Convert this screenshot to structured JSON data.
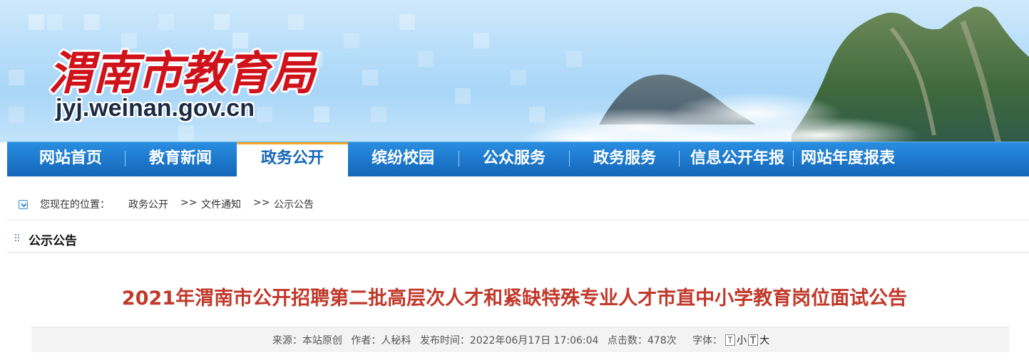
{
  "site": {
    "logo_cn": "渭南市教育局",
    "logo_url": "jyj.weinan.gov.cn"
  },
  "nav": {
    "items": [
      {
        "label": "网站首页"
      },
      {
        "label": "教育新闻"
      },
      {
        "label": "政务公开"
      },
      {
        "label": "缤纷校园"
      },
      {
        "label": "公众服务"
      },
      {
        "label": "政务服务"
      },
      {
        "label": "信息公开年报"
      },
      {
        "label": "网站年度报表"
      }
    ],
    "active_index": 2,
    "colors": {
      "bar": "#1e79cd",
      "active_text": "#1466b8",
      "active_accent": "#f5a623"
    }
  },
  "breadcrumb": {
    "prefix": "您现在的位置：",
    "items": [
      "政务公开",
      "文件通知",
      "公示公告"
    ],
    "separator": ">>"
  },
  "section": {
    "title": "公示公告"
  },
  "article": {
    "title": "2021年渭南市公开招聘第二批高层次人才和紧缺特殊专业人才市直中小学教育岗位面试公告",
    "title_color": "#c0392b",
    "meta": {
      "source": "来源：本站原创",
      "author": "作者：人秘科",
      "published": "发布时间：2022年06月17日 17:06:04",
      "clicks": "点击数：478次",
      "font_label": "字体：",
      "font_small": "小",
      "font_large": "大"
    }
  }
}
